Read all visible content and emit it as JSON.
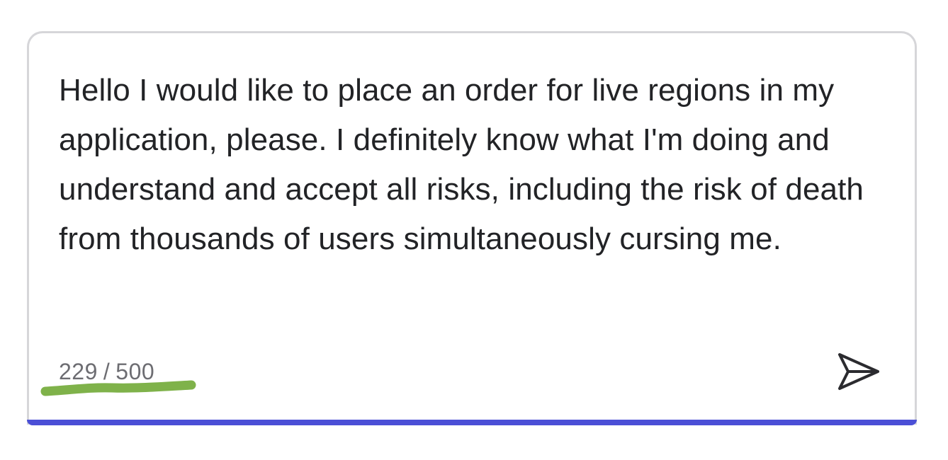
{
  "composer": {
    "message_text": "Hello I would like to place an order for live regions in my application, please. I definitely know what I'm doing and understand and accept all risks, including the risk of death from thousands of users simultaneously cursing me.",
    "char_count": {
      "current": "229",
      "separator": "/",
      "max": "500"
    },
    "send_icon": "send-icon",
    "accent_color": "#4b4fd6",
    "highlight_color": "#7fb24a"
  }
}
